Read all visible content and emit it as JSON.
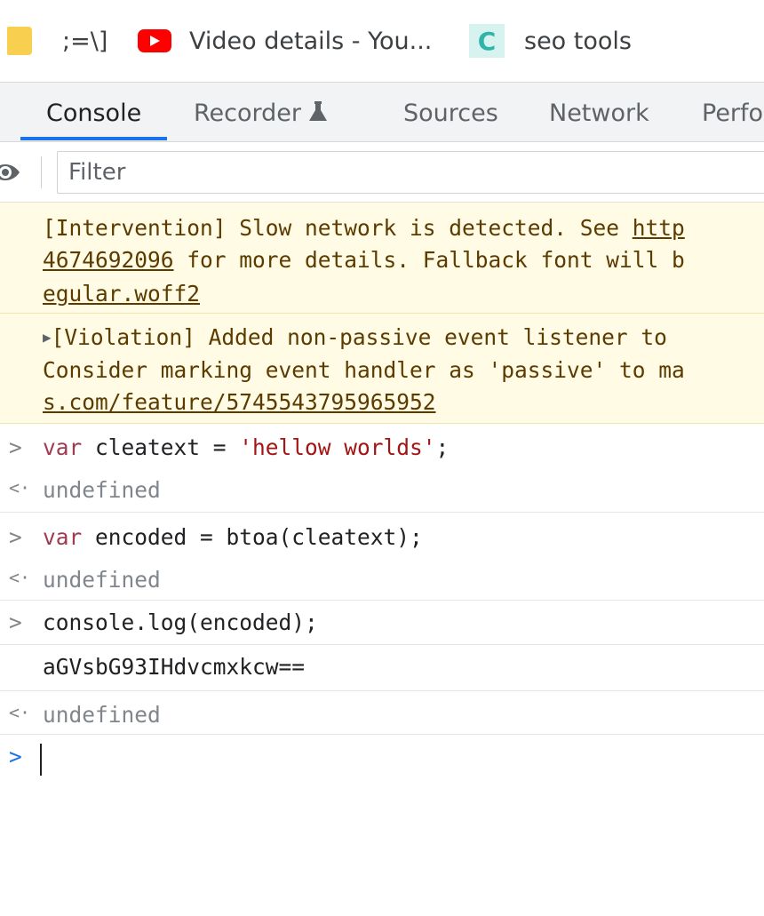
{
  "bookmarks": {
    "items": [
      {
        "label": ";=\\]",
        "icon": "folder-icon",
        "color": "#f9cf4f"
      },
      {
        "label": "Video details - You...",
        "icon": "youtube-icon",
        "color": "#ff0000"
      },
      {
        "label": "seo tools",
        "icon": "letter-c-icon",
        "glyph": "C",
        "color": "#2eb5a7"
      }
    ]
  },
  "devtools": {
    "tabs": [
      {
        "label": "Console",
        "active": true
      },
      {
        "label": "Recorder",
        "icon": "flask-icon"
      },
      {
        "label": "Sources"
      },
      {
        "label": "Network"
      },
      {
        "label": "Perfo"
      }
    ],
    "accent": "#1a73e8"
  },
  "filter": {
    "placeholder": "Filter"
  },
  "console": {
    "warnings": [
      {
        "line1_prefix": "[Intervention] Slow network is detected. See ",
        "line1_link": "http",
        "line2_link": "4674692096",
        "line2_rest": " for more details. Fallback font will b",
        "line3_link": "egular.woff2"
      },
      {
        "line1": "[Violation] Added non-passive event listener to",
        "line2": "Consider marking event handler as 'passive' to ma",
        "line3_link": "s.com/feature/5745543795965952"
      }
    ],
    "entries": [
      {
        "kw": "var",
        "code": " cleatext = ",
        "str": "'hellow worlds'",
        "tail": ";",
        "result": "undefined"
      },
      {
        "kw": "var",
        "code": " encoded = btoa(cleatext);",
        "result": "undefined"
      },
      {
        "code": "console.log(encoded);",
        "log_output": "aGVsbG93IHdvcmxkcw==",
        "result": "undefined"
      }
    ],
    "prompt_glyph": ">",
    "result_glyph": "<·"
  }
}
